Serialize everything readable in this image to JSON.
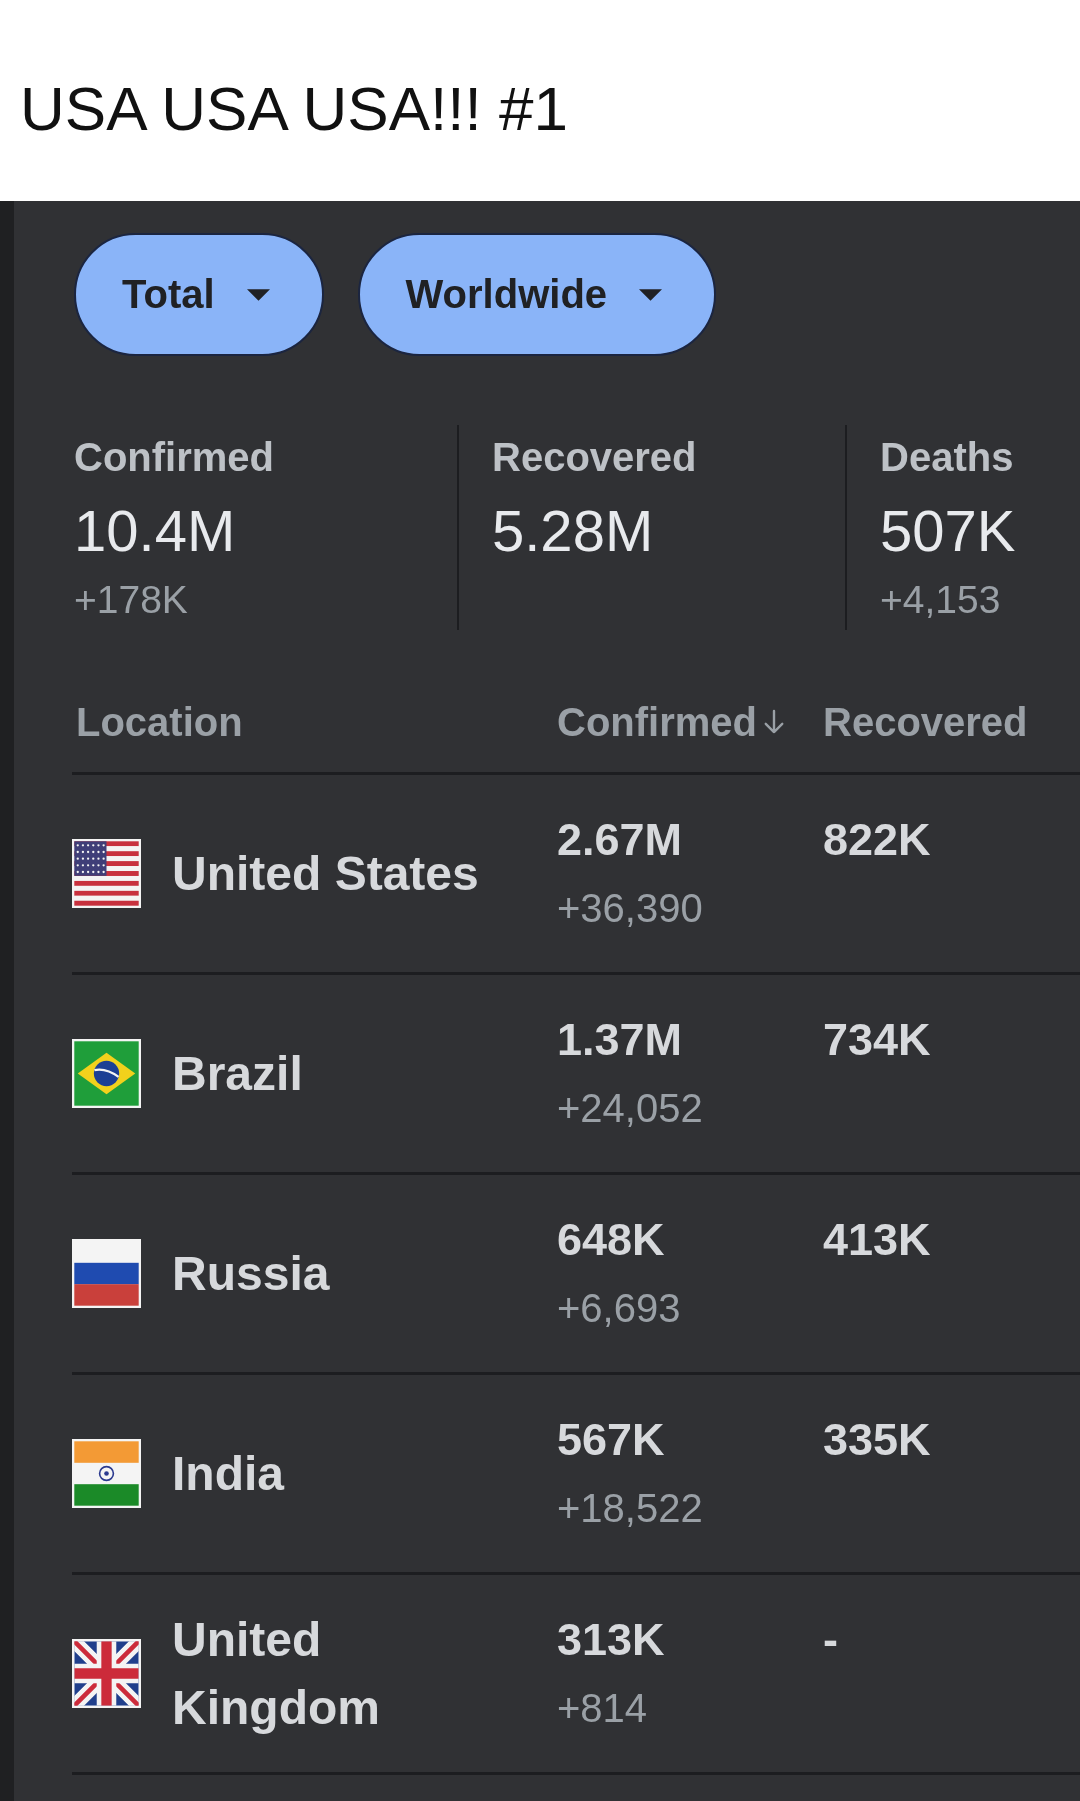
{
  "title": "USA USA USA!!! #1",
  "filters": [
    {
      "label": "Total"
    },
    {
      "label": "Worldwide"
    }
  ],
  "stats": [
    {
      "label": "Confirmed",
      "value": "10.4M",
      "delta": "+178K"
    },
    {
      "label": "Recovered",
      "value": "5.28M"
    },
    {
      "label": "Deaths",
      "value": "507K",
      "delta": "+4,153"
    }
  ],
  "table": {
    "columns": [
      {
        "label": "Location",
        "sorted": false
      },
      {
        "label": "Confirmed",
        "sorted": true
      },
      {
        "label": "Recovered",
        "sorted": false
      }
    ],
    "rows": [
      {
        "kind": "us",
        "location": "United States",
        "confirmed": "2.67M",
        "confirmed_delta": "+36,390",
        "recovered": "822K"
      },
      {
        "kind": "br",
        "location": "Brazil",
        "confirmed": "1.37M",
        "confirmed_delta": "+24,052",
        "recovered": "734K"
      },
      {
        "kind": "ru",
        "location": "Russia",
        "confirmed": "648K",
        "confirmed_delta": "+6,693",
        "recovered": "413K"
      },
      {
        "kind": "in",
        "location": "India",
        "confirmed": "567K",
        "confirmed_delta": "+18,522",
        "recovered": "335K"
      },
      {
        "kind": "gb",
        "location": "United Kingdom",
        "confirmed": "313K",
        "confirmed_delta": "+814",
        "recovered": "-"
      }
    ]
  }
}
